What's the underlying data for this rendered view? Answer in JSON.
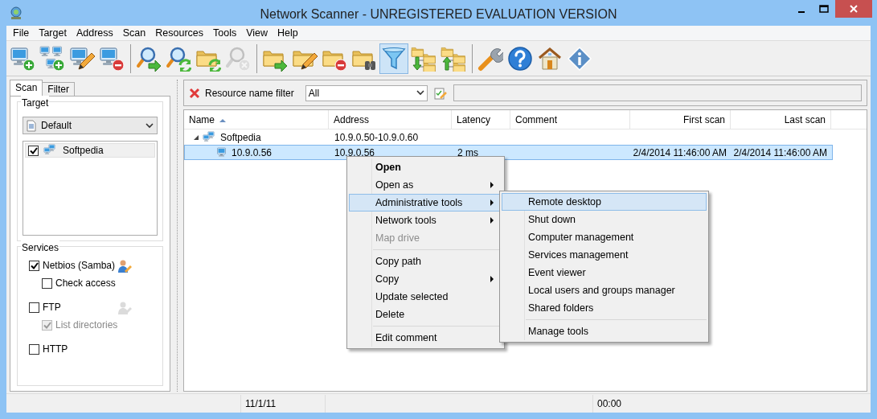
{
  "window": {
    "title": "Network Scanner - UNREGISTERED EVALUATION VERSION"
  },
  "menu": [
    "File",
    "Target",
    "Address",
    "Scan",
    "Resources",
    "Tools",
    "View",
    "Help"
  ],
  "toolbar": [
    [
      {
        "kind": "computer-add",
        "selected": false,
        "disabled": false
      },
      {
        "kind": "network-add",
        "selected": false,
        "disabled": false
      },
      {
        "kind": "computer-edit",
        "selected": false,
        "disabled": false
      },
      {
        "kind": "computer-remove",
        "selected": false,
        "disabled": false
      }
    ],
    [
      {
        "kind": "search-go",
        "selected": false,
        "disabled": false
      },
      {
        "kind": "search-refresh",
        "selected": false,
        "disabled": false
      },
      {
        "kind": "folder-refresh",
        "selected": false,
        "disabled": false
      },
      {
        "kind": "search-stop",
        "selected": false,
        "disabled": true
      }
    ],
    [
      {
        "kind": "folder-go",
        "selected": false,
        "disabled": false
      },
      {
        "kind": "folder-edit",
        "selected": false,
        "disabled": false
      },
      {
        "kind": "folder-remove",
        "selected": false,
        "disabled": false
      },
      {
        "kind": "folder-find",
        "selected": false,
        "disabled": false
      },
      {
        "kind": "filter",
        "selected": true,
        "disabled": false
      },
      {
        "kind": "tree-down",
        "selected": false,
        "disabled": false
      },
      {
        "kind": "tree-up",
        "selected": false,
        "disabled": false
      }
    ],
    [
      {
        "kind": "wrench",
        "selected": false,
        "disabled": false
      },
      {
        "kind": "help",
        "selected": false,
        "disabled": false
      },
      {
        "kind": "home",
        "selected": false,
        "disabled": false
      },
      {
        "kind": "info",
        "selected": false,
        "disabled": false
      }
    ]
  ],
  "left_panel": {
    "tabs": [
      {
        "label": "Scan",
        "selected": true
      },
      {
        "label": "Filter",
        "selected": false
      }
    ],
    "target": {
      "legend": "Target",
      "profile": "Default",
      "items": [
        {
          "label": "Softpedia",
          "checked": true,
          "selected": true
        }
      ]
    },
    "services": {
      "legend": "Services",
      "items": [
        {
          "label": "Netbios (Samba)",
          "checked": true,
          "credentials_icon": true,
          "children": [
            {
              "label": "Check access",
              "checked": false,
              "disabled": false
            }
          ]
        },
        {
          "label": "FTP",
          "checked": false,
          "credentials_icon": true,
          "children": [
            {
              "label": "List directories",
              "checked": true,
              "disabled": true
            }
          ]
        },
        {
          "label": "HTTP",
          "checked": false,
          "credentials_icon": false
        }
      ]
    }
  },
  "filter_bar": {
    "label": "Resource name filter",
    "dropdown": "All"
  },
  "table": {
    "columns": [
      {
        "label": "Name",
        "sorted": true
      },
      {
        "label": "Address",
        "sorted": false
      },
      {
        "label": "Latency",
        "sorted": false
      },
      {
        "label": "Comment",
        "sorted": false
      },
      {
        "label": "First scan",
        "sorted": false
      },
      {
        "label": "Last scan",
        "sorted": false
      }
    ],
    "rows": [
      {
        "kind": "group",
        "name": "Softpedia",
        "address": "10.9.0.50-10.9.0.60",
        "expanded": true,
        "selected": false,
        "children": [
          {
            "kind": "host",
            "name": "10.9.0.56",
            "address": "10.9.0.56",
            "latency": "2 ms",
            "first_scan": "2/4/2014 11:46:00 AM",
            "last_scan": "2/4/2014 11:46:00 AM",
            "selected": true
          }
        ]
      }
    ]
  },
  "context_menu": {
    "items": [
      {
        "kind": "item",
        "label": "Open",
        "bold": true,
        "disabled": false,
        "submenu": false,
        "selected": false
      },
      {
        "kind": "item",
        "label": "Open as",
        "bold": false,
        "disabled": false,
        "submenu": true,
        "selected": false
      },
      {
        "kind": "item",
        "label": "Administrative tools",
        "bold": false,
        "disabled": false,
        "submenu": true,
        "selected": true
      },
      {
        "kind": "item",
        "label": "Network tools",
        "bold": false,
        "disabled": false,
        "submenu": true,
        "selected": false
      },
      {
        "kind": "item",
        "label": "Map drive",
        "bold": false,
        "disabled": true,
        "submenu": false,
        "selected": false
      },
      {
        "kind": "separator"
      },
      {
        "kind": "item",
        "label": "Copy path",
        "bold": false,
        "disabled": false,
        "submenu": false,
        "selected": false
      },
      {
        "kind": "item",
        "label": "Copy",
        "bold": false,
        "disabled": false,
        "submenu": true,
        "selected": false
      },
      {
        "kind": "item",
        "label": "Update selected",
        "bold": false,
        "disabled": false,
        "submenu": false,
        "selected": false
      },
      {
        "kind": "item",
        "label": "Delete",
        "bold": false,
        "disabled": false,
        "submenu": false,
        "selected": false
      },
      {
        "kind": "separator"
      },
      {
        "kind": "item",
        "label": "Edit comment",
        "bold": false,
        "disabled": false,
        "submenu": false,
        "selected": false
      }
    ]
  },
  "submenu": {
    "items": [
      {
        "kind": "item",
        "label": "Remote desktop",
        "selected": true
      },
      {
        "kind": "item",
        "label": "Shut down",
        "selected": false
      },
      {
        "kind": "item",
        "label": "Computer management",
        "selected": false
      },
      {
        "kind": "item",
        "label": "Services management",
        "selected": false
      },
      {
        "kind": "item",
        "label": "Event viewer",
        "selected": false
      },
      {
        "kind": "item",
        "label": "Local users and groups manager",
        "selected": false
      },
      {
        "kind": "item",
        "label": "Shared folders",
        "selected": false
      },
      {
        "kind": "separator"
      },
      {
        "kind": "item",
        "label": "Manage tools",
        "selected": false
      }
    ]
  },
  "status_bar": {
    "date": "11/1/11",
    "time": "00:00"
  }
}
